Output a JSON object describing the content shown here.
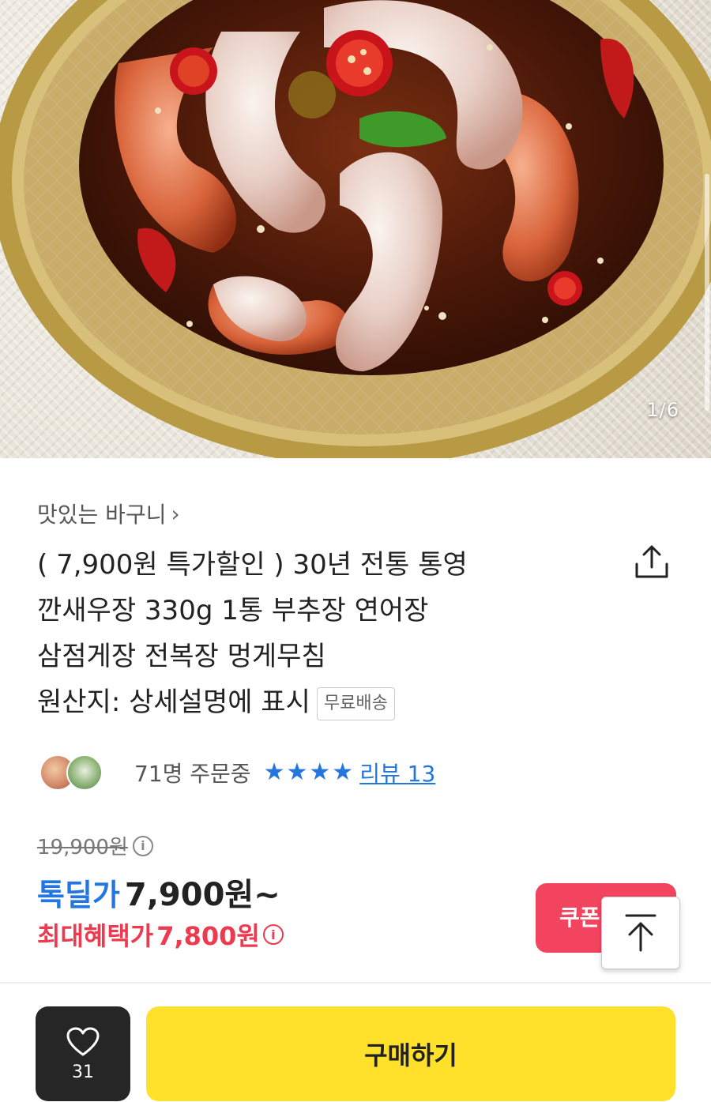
{
  "gallery": {
    "counter": "1/6",
    "image_alt": "product-photo-marinated-shrimp"
  },
  "product": {
    "seller": "맛있는 바구니",
    "seller_chevron": "›",
    "title_lines": [
      "( 7,900원 특가할인 ) 30년 전통 통영",
      "깐새우장 330g 1통 부추장 연어장",
      "삼점게장 전복장 멍게무침",
      "원산지: 상세설명에 표시"
    ],
    "shipping_badge": "무료배송"
  },
  "stats": {
    "orders": "71명 주문중",
    "rating_stars": 4,
    "review_link": "리뷰 13"
  },
  "price": {
    "original": "19,900원",
    "deal_label": "톡딜가",
    "deal_value": "7,900원~",
    "max_benefit_label": "최대혜택가",
    "max_benefit_value": "7,800원"
  },
  "actions": {
    "coupon_label": "쿠폰",
    "like_count": "31",
    "buy_label": "구매하기"
  },
  "colors": {
    "accent_blue": "#2376e0",
    "accent_red": "#ee3a4f",
    "buy_yellow": "#ffe02b",
    "coupon_pink": "#f2445f",
    "dark": "#262626"
  },
  "icons": [
    "share-icon",
    "info-icon",
    "star-icon",
    "scroll-top-icon",
    "heart-icon",
    "chevron-right-icon"
  ]
}
